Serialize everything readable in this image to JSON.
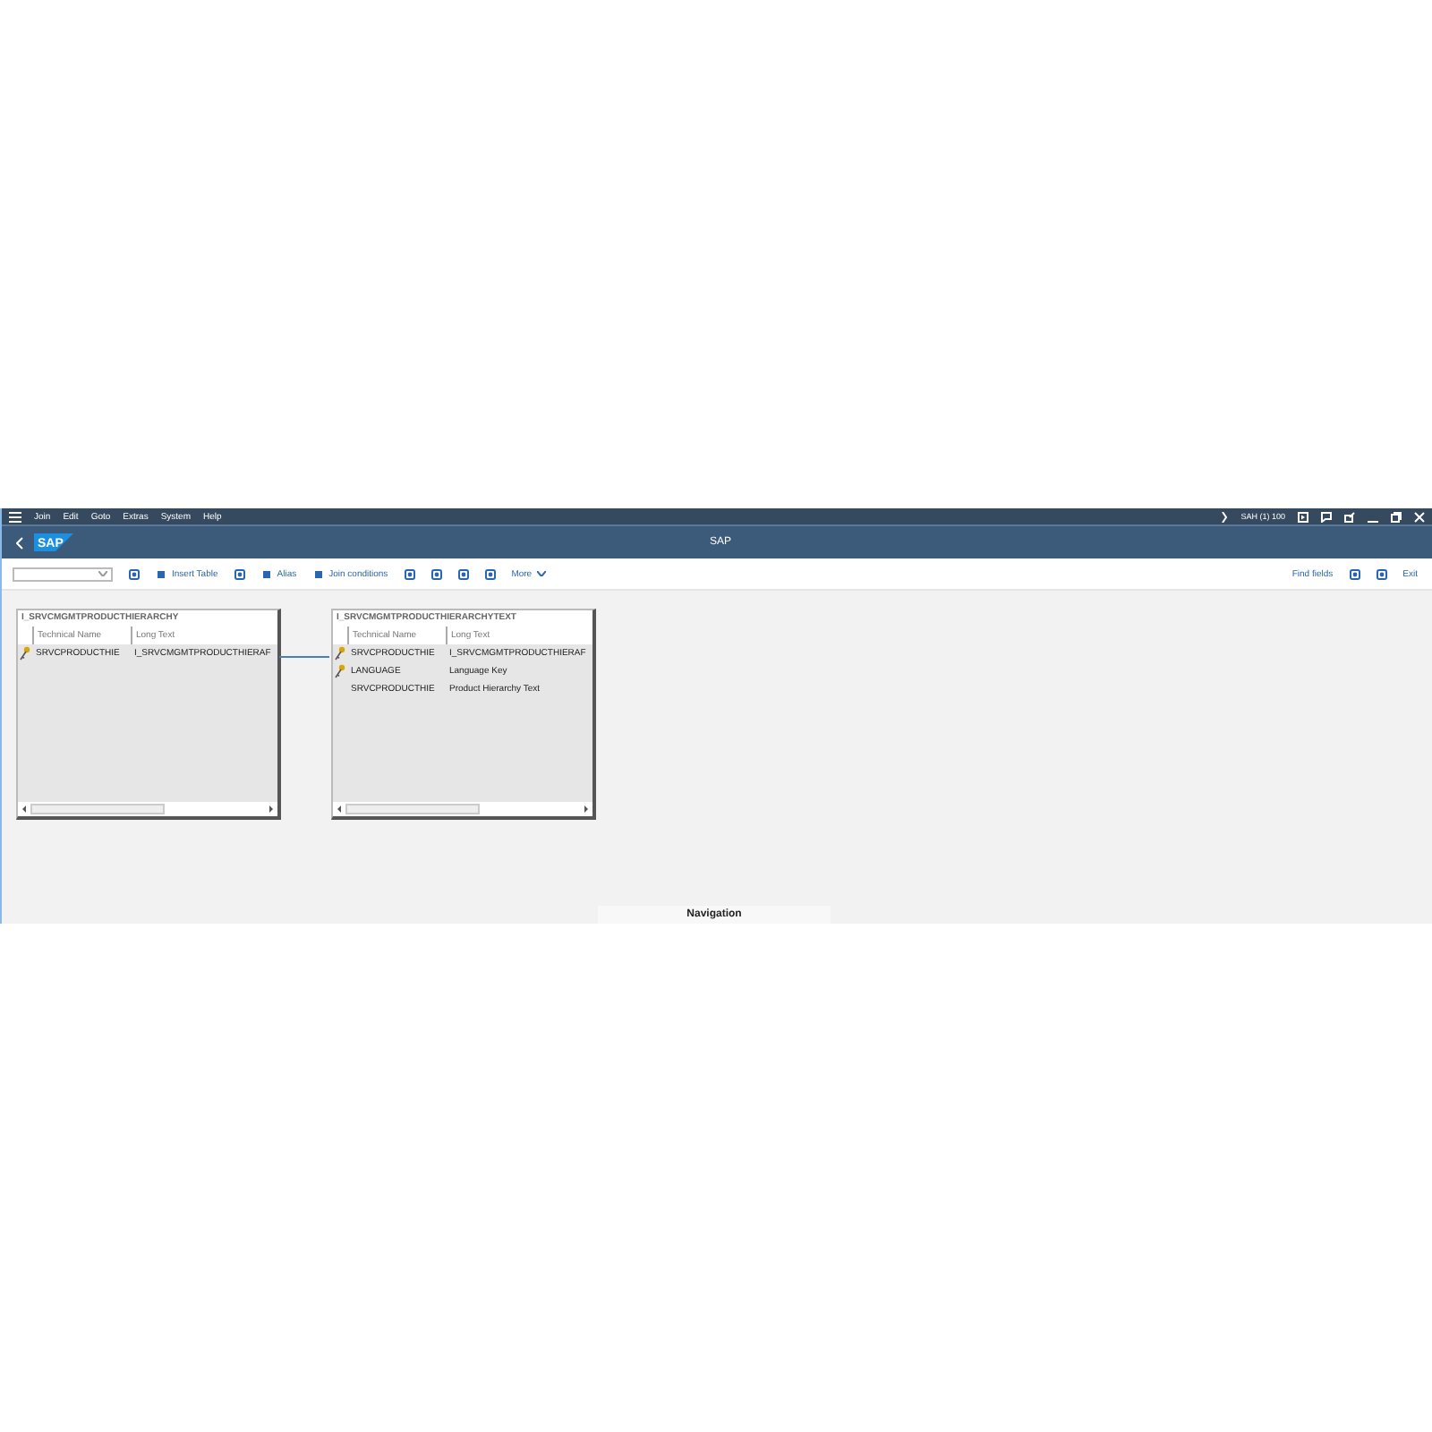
{
  "menu": [
    "Join",
    "Edit",
    "Goto",
    "Extras",
    "System",
    "Help"
  ],
  "system_info": "SAH (1) 100",
  "logo_text": "SAP",
  "title": "SAP",
  "toolbar": [
    {
      "kind": "dropdown"
    },
    {
      "kind": "icon"
    },
    {
      "kind": "button",
      "label": "Insert Table"
    },
    {
      "kind": "icon"
    },
    {
      "kind": "button",
      "label": "Alias"
    },
    {
      "kind": "button",
      "label": "Join conditions"
    },
    {
      "kind": "icon"
    },
    {
      "kind": "icon"
    },
    {
      "kind": "icon"
    },
    {
      "kind": "icon"
    },
    {
      "kind": "more",
      "label": "More"
    }
  ],
  "toolbar_right": [
    {
      "kind": "button",
      "label": "Find fields"
    },
    {
      "kind": "icon"
    },
    {
      "kind": "icon"
    },
    {
      "kind": "button",
      "label": "Exit"
    }
  ],
  "tables": [
    {
      "title": "I_SRVCMGMTPRODUCTHIERARCHY",
      "columns": [
        "Technical Name",
        "Long Text"
      ],
      "rows": [
        {
          "key": true,
          "cells": [
            "SRVCPRODUCTHIE",
            "I_SRVCMGMTPRODUCTHIERAF"
          ]
        }
      ]
    },
    {
      "title": "I_SRVCMGMTPRODUCTHIERARCHYTEXT",
      "columns": [
        "Technical Name",
        "Long Text"
      ],
      "rows": [
        {
          "key": true,
          "cells": [
            "SRVCPRODUCTHIE",
            "I_SRVCMGMTPRODUCTHIERAF"
          ]
        },
        {
          "key": true,
          "cells": [
            "LANGUAGE",
            "Language Key"
          ]
        },
        {
          "key": false,
          "cells": [
            "SRVCPRODUCTHIE",
            "Product Hierarchy Text"
          ]
        }
      ]
    }
  ],
  "navigation_panel": {
    "title": "Navigation"
  }
}
